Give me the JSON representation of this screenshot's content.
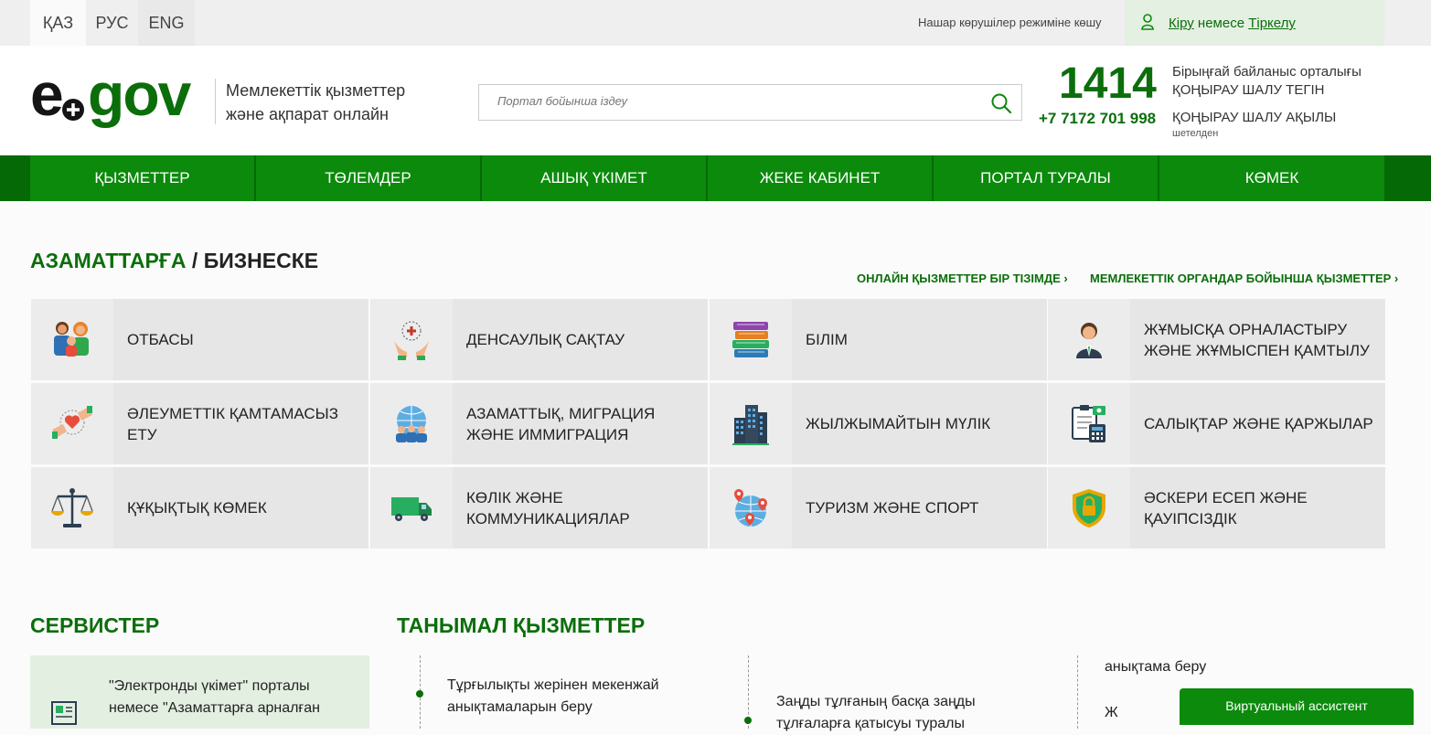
{
  "topbar": {
    "languages": [
      "ҚАЗ",
      "РУС",
      "ENG"
    ],
    "accessibility": "Нашар көрушілер режиміне көшу",
    "login": "Кіру",
    "login_or": "немесе",
    "register": "Тіркелу"
  },
  "header": {
    "logo_e": "e",
    "logo_gov": "gov",
    "tagline_1": "Мемлекеттік қызметтер",
    "tagline_2": "және ақпарат онлайн",
    "search_placeholder": "Портал бойынша іздеу",
    "phone_main": "1414",
    "phone_alt": "+7 7172 701 998",
    "contact_center": "Бірыңғай байланыс орталығы",
    "call_free": "ҚОҢЫРАУ ШАЛУ ТЕГІН",
    "call_paid": "ҚОҢЫРАУ ШАЛУ АҚЫЛЫ",
    "abroad": "шетелден"
  },
  "nav": [
    "ҚЫЗМЕТТЕР",
    "ТӨЛЕМДЕР",
    "АШЫҚ ҮКІМЕТ",
    "ЖЕКЕ КАБИНЕТ",
    "ПОРТАЛ ТУРАЛЫ",
    "КӨМЕК"
  ],
  "citizens": {
    "title_green": "АЗАМАТТАРҒА",
    "title_sep": " / ",
    "title_dark": "БИЗНЕСКЕ",
    "link_list": "ОНЛАЙН ҚЫЗМЕТТЕР БІР ТІЗІМДЕ ›",
    "link_agencies": "МЕМЛЕКЕТТІК ОРГАНДАР БОЙЫНША ҚЫЗМЕТТЕР ›",
    "tiles": [
      {
        "label": "ОТБАСЫ",
        "icon": "family-icon"
      },
      {
        "label": "ДЕНСАУЛЫҚ САҚТАУ",
        "icon": "healthcare-icon"
      },
      {
        "label": "БІЛІМ",
        "icon": "books-icon"
      },
      {
        "label": "ЖҰМЫСҚА ОРНАЛАСТЫРУ ЖӘНЕ ЖҰМЫСПЕН ҚАМТЫЛУ",
        "icon": "employee-icon"
      },
      {
        "label": "ӘЛЕУМЕТТІК ҚАМТАМАСЫЗ ЕТУ",
        "icon": "social-care-icon"
      },
      {
        "label": "АЗАМАТТЫҚ, МИГРАЦИЯ ЖӘНЕ ИММИГРАЦИЯ",
        "icon": "globe-people-icon"
      },
      {
        "label": "ЖЫЛЖЫМАЙТЫН МҮЛІК",
        "icon": "buildings-icon"
      },
      {
        "label": "САЛЫҚТАР ЖӘНЕ ҚАРЖЫЛАР",
        "icon": "tax-calculator-icon"
      },
      {
        "label": "ҚҰҚЫҚТЫҚ КӨМЕК",
        "icon": "scales-icon"
      },
      {
        "label": "КӨЛІК ЖӘНЕ КОММУНИКАЦИЯЛАР",
        "icon": "truck-icon"
      },
      {
        "label": "ТУРИЗМ ЖӘНЕ СПОРТ",
        "icon": "globe-pins-icon"
      },
      {
        "label": "ӘСКЕРИ ЕСЕП ЖӘНЕ ҚАУІПСІЗДІК",
        "icon": "shield-lock-icon"
      }
    ]
  },
  "services": {
    "title": "СЕРВИСТЕР",
    "card_text_1": "\"Электронды үкімет\" порталы",
    "card_text_2": "немесе \"Азаматтарға арналған"
  },
  "popular": {
    "title": "ТАНЫМАЛ ҚЫЗМЕТТЕР",
    "col1_line1": "Тұрғылықты жерінен мекенжай",
    "col1_line2": "анықтамаларын беру",
    "col2_line1": "Заңды тұлғаның басқа заңды",
    "col2_line2": "тұлғаларға қатысуы туралы",
    "col3_line1": "анықтама беру",
    "col3_line2": "Ж"
  },
  "assistant": "Виртуальный ассистент"
}
